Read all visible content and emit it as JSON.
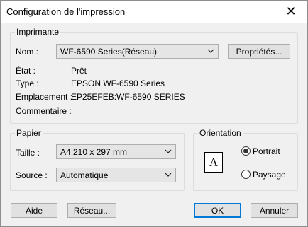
{
  "window": {
    "title": "Configuration de l'impression",
    "close_glyph": "✕"
  },
  "printer": {
    "group_label": "Imprimante",
    "name_label": "Nom :",
    "name_value": "WF-6590 Series(Réseau)",
    "properties_button": "Propriétés...",
    "status_label": "État :",
    "status_value": "Prêt",
    "type_label": "Type :",
    "type_value": "EPSON WF-6590 Series",
    "location_label": "Emplacement :",
    "location_value": "EP25EFEB:WF-6590 SERIES",
    "comment_label": "Commentaire :"
  },
  "paper": {
    "group_label": "Papier",
    "size_label": "Taille :",
    "size_value": "A4 210 x 297 mm",
    "source_label": "Source :",
    "source_value": "Automatique"
  },
  "orientation": {
    "group_label": "Orientation",
    "page_glyph": "A",
    "portrait_label": "Portrait",
    "landscape_label": "Paysage",
    "selected": "portrait"
  },
  "footer": {
    "help_button": "Aide",
    "network_button": "Réseau...",
    "ok_button": "OK",
    "cancel_button": "Annuler"
  },
  "colors": {
    "default_button_border": "#0078d7",
    "dialog_background": "#f0f0f0"
  }
}
